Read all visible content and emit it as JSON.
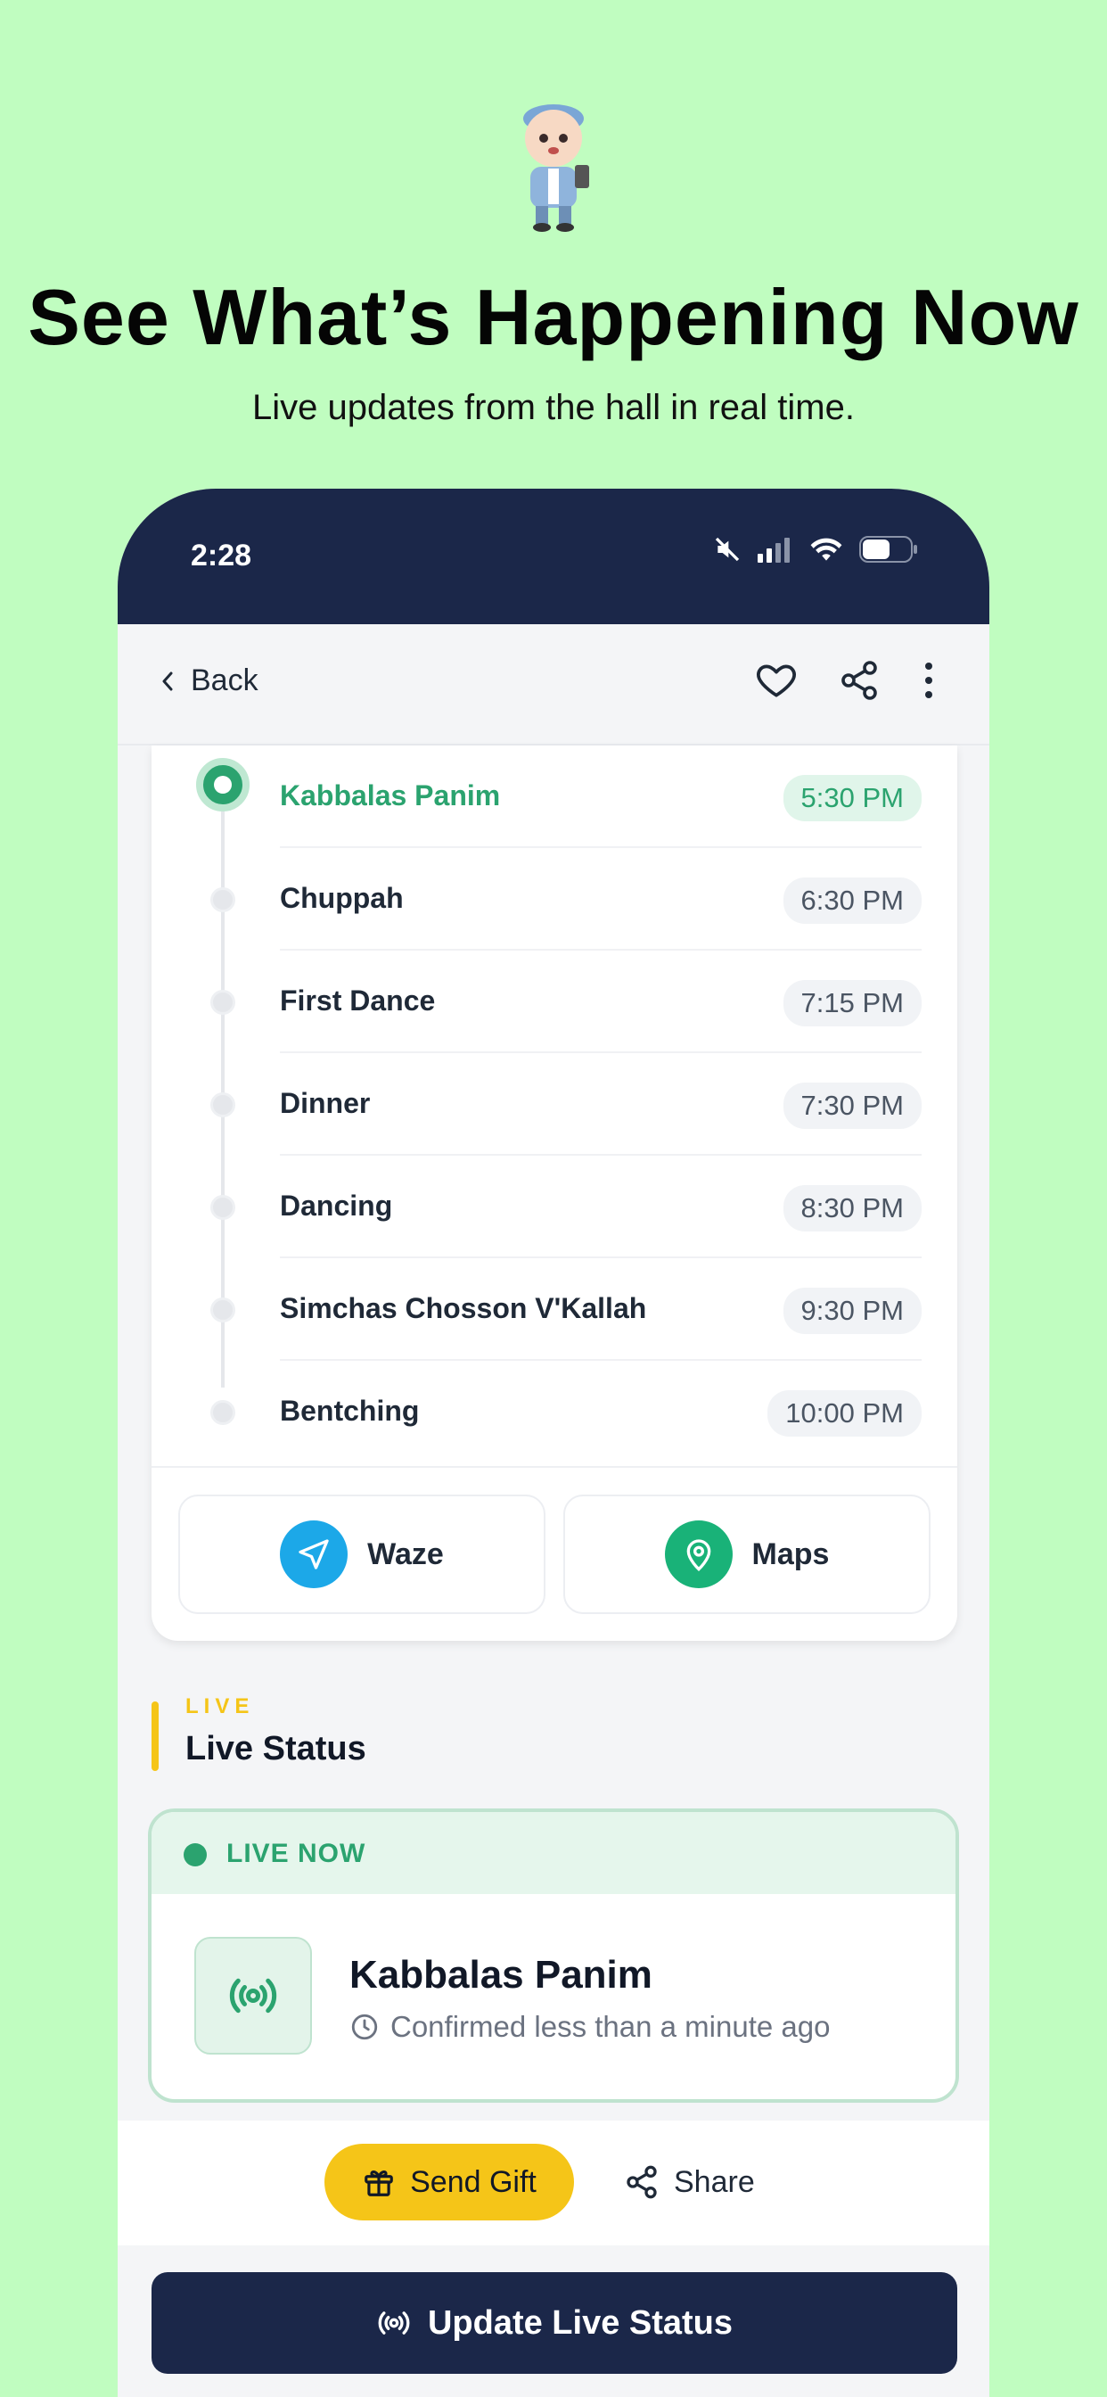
{
  "promo": {
    "headline": "See What’s Happening Now",
    "subhead": "Live updates from the hall in real time."
  },
  "status_bar": {
    "time": "2:28"
  },
  "navbar": {
    "back_label": "Back"
  },
  "timeline": {
    "items": [
      {
        "label": "Kabbalas Panim",
        "time": "5:30 PM",
        "active": true
      },
      {
        "label": "Chuppah",
        "time": "6:30 PM",
        "active": false
      },
      {
        "label": "First Dance",
        "time": "7:15 PM",
        "active": false
      },
      {
        "label": "Dinner",
        "time": "7:30 PM",
        "active": false
      },
      {
        "label": "Dancing",
        "time": "8:30 PM",
        "active": false
      },
      {
        "label": "Simchas Chosson V'Kallah",
        "time": "9:30 PM",
        "active": false
      },
      {
        "label": "Bentching",
        "time": "10:00 PM",
        "active": false
      }
    ]
  },
  "navigation": {
    "waze_label": "Waze",
    "maps_label": "Maps"
  },
  "live_section": {
    "kicker": "LIVE",
    "title": "Live Status",
    "badge": "LIVE NOW",
    "current_event": "Kabbalas Panim",
    "confirmed_text": "Confirmed less than a minute ago"
  },
  "actions": {
    "send_gift_label": "Send Gift",
    "share_label": "Share"
  },
  "update_button": {
    "label": "Update Live Status"
  },
  "colors": {
    "background": "#c0fdc0",
    "navy": "#1b2749",
    "accent_green": "#2ba36f",
    "accent_yellow": "#f5c518",
    "waze_blue": "#1ca8e8"
  }
}
